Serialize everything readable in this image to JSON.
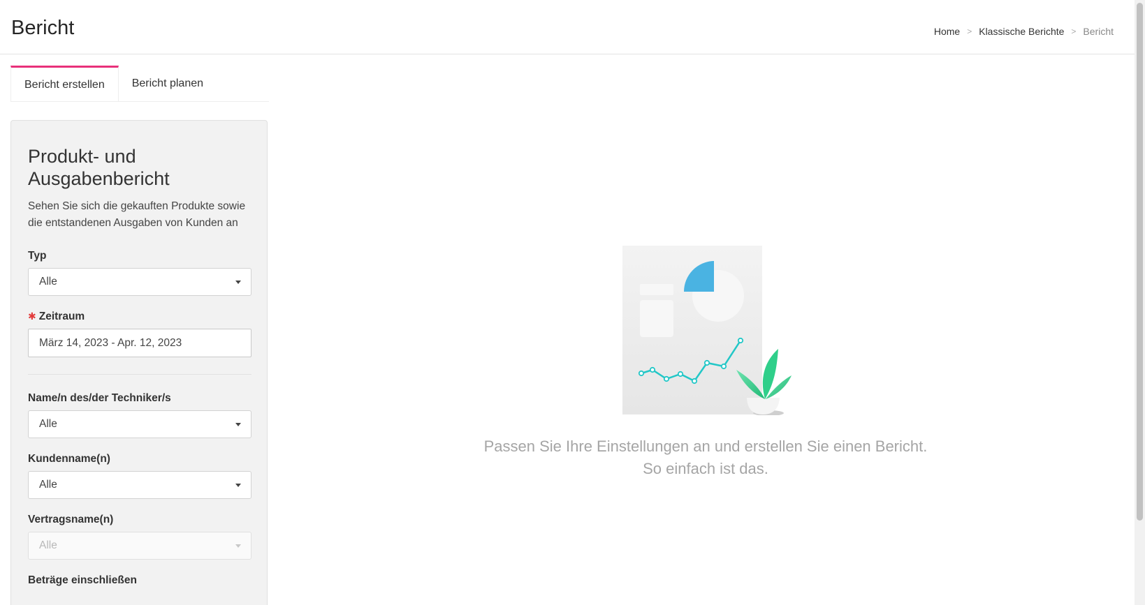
{
  "header": {
    "title": "Bericht",
    "breadcrumb": {
      "home": "Home",
      "section": "Klassische Berichte",
      "current": "Bericht",
      "separator": ">"
    }
  },
  "tabs": [
    {
      "label": "Bericht erstellen",
      "active": true
    },
    {
      "label": "Bericht planen",
      "active": false
    }
  ],
  "panel": {
    "title_line1": "Produkt- und",
    "title_line2": "Ausgabenbericht",
    "description": "Sehen Sie sich die gekauften Produkte sowie die entstandenen Ausgaben von Kunden an",
    "fields": {
      "typ": {
        "label": "Typ",
        "value": "Alle"
      },
      "zeitraum": {
        "label": "Zeitraum",
        "required_mark": "✱",
        "value": "März 14, 2023 - Apr. 12, 2023"
      },
      "techniker": {
        "label": "Name/n des/der Techniker/s",
        "value": "Alle"
      },
      "kunden": {
        "label": "Kundenname(n)",
        "value": "Alle"
      },
      "vertrag": {
        "label": "Vertragsname(n)",
        "value": "Alle",
        "disabled": true
      },
      "betraege": {
        "label": "Beträge einschließen"
      }
    }
  },
  "empty_state": {
    "line1": "Passen Sie Ihre Einstellungen an und erstellen Sie einen Bericht.",
    "line2": "So einfach ist das."
  },
  "colors": {
    "accent_tab": "#e8317a",
    "required": "#e23b3b",
    "illus_blue": "#4ab3e2",
    "illus_teal": "#22c7c7",
    "illus_green": "#2fcf8a"
  }
}
